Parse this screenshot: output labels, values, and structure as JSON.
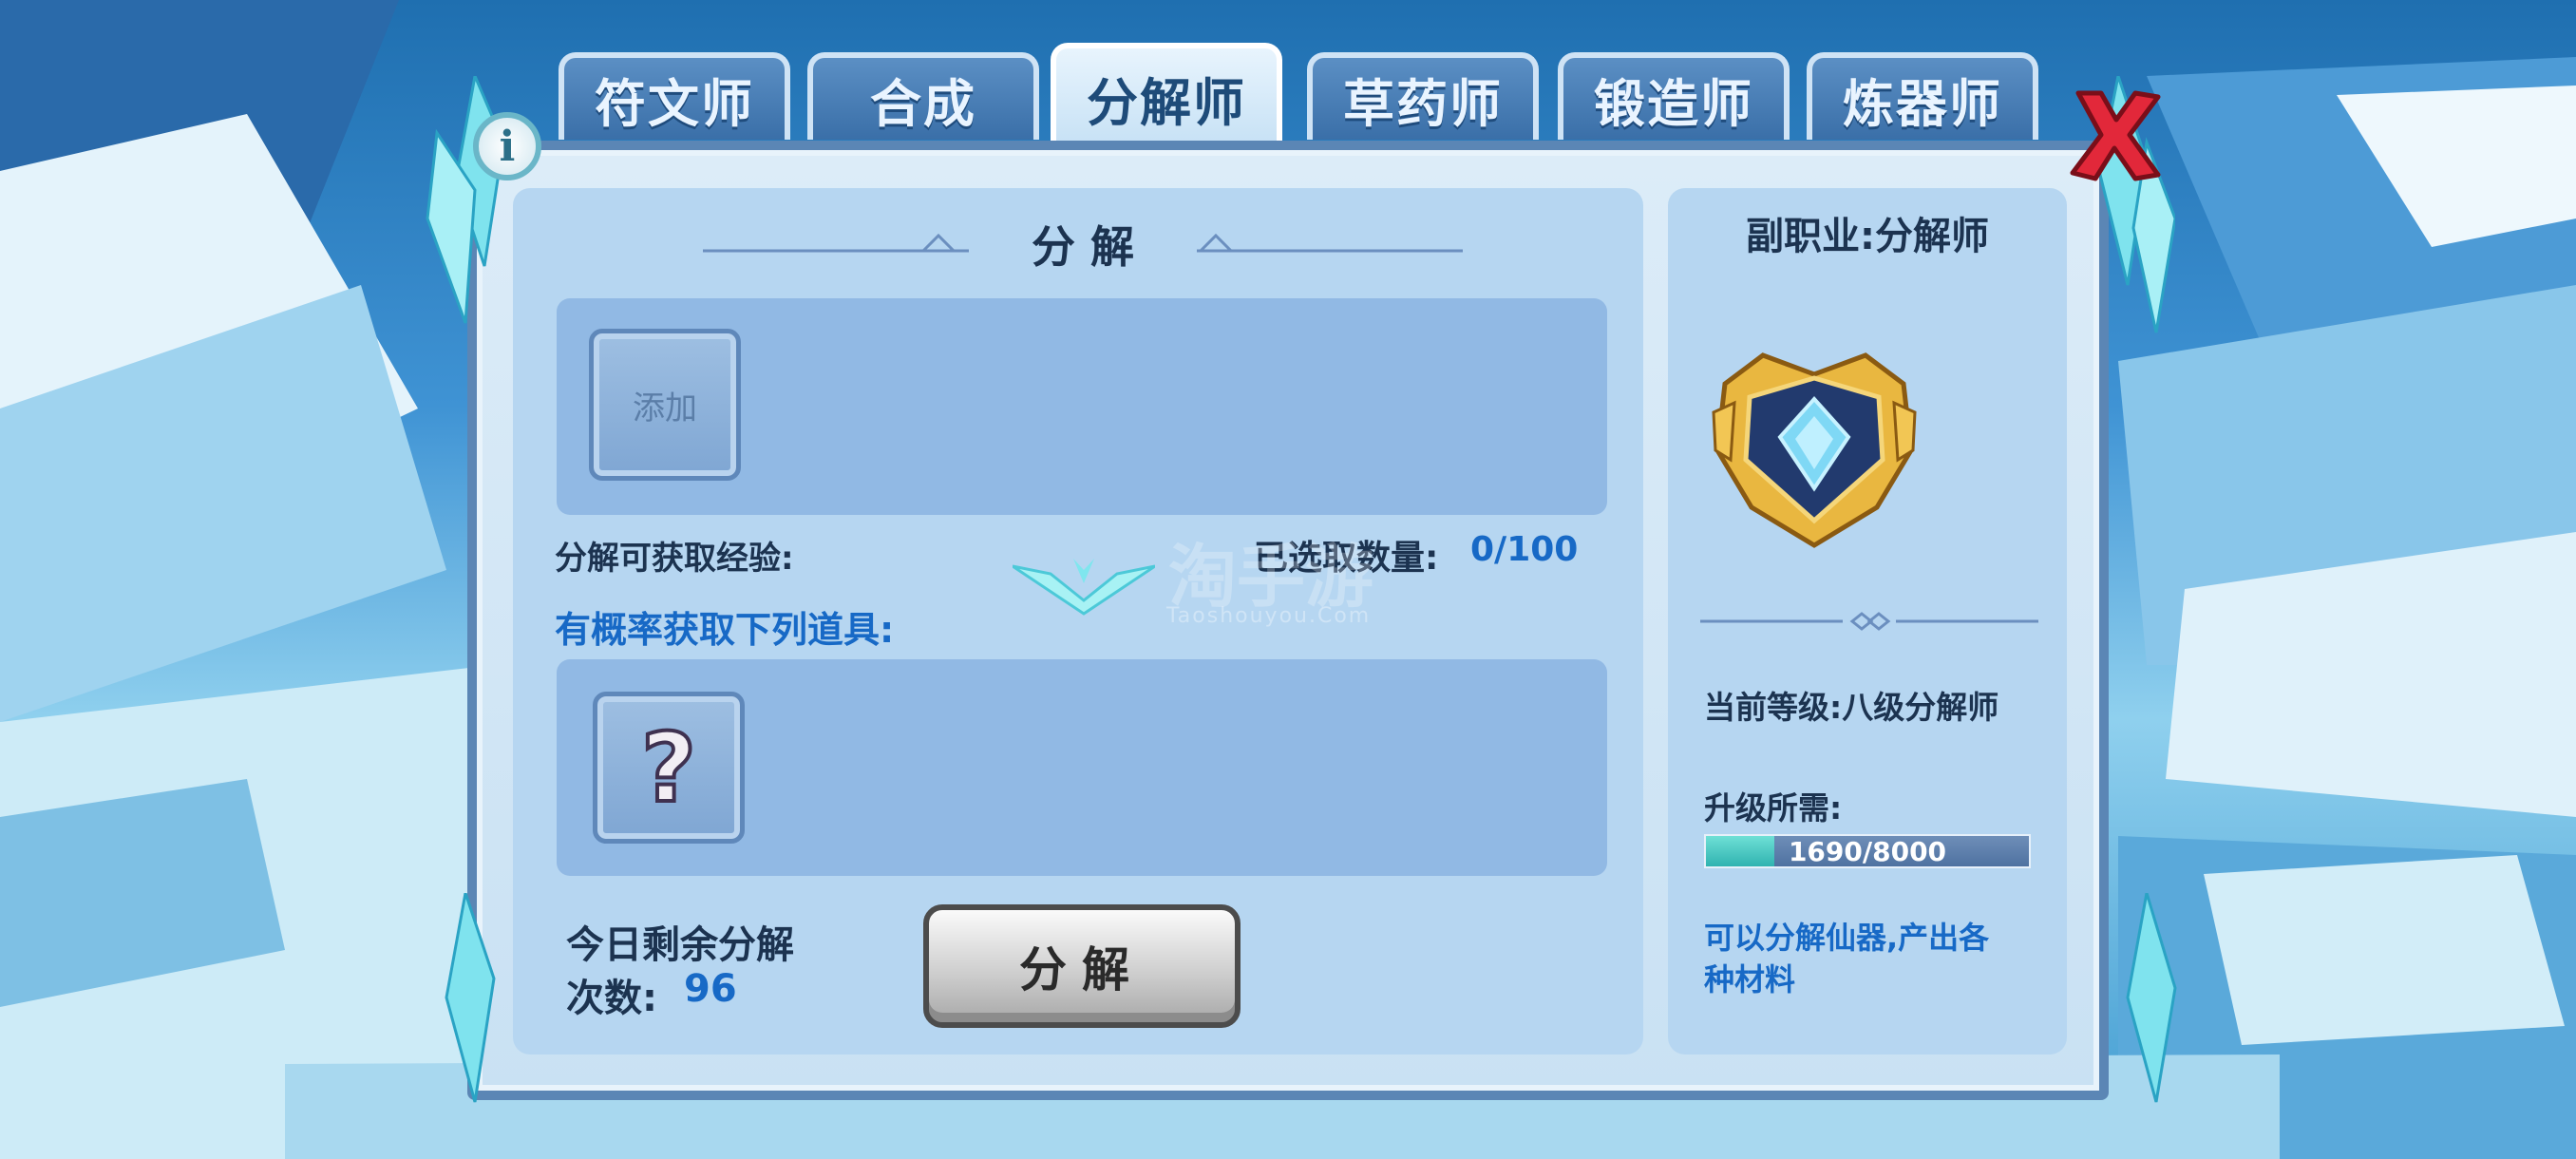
{
  "tabs": [
    {
      "label": "符文师",
      "active": false
    },
    {
      "label": "合成",
      "active": false
    },
    {
      "label": "分解师",
      "active": true
    },
    {
      "label": "草药师",
      "active": false
    },
    {
      "label": "锻造师",
      "active": false
    },
    {
      "label": "炼器师",
      "active": false
    }
  ],
  "main": {
    "section_title": "分 解",
    "add_slot_label": "添加",
    "exp_label": "分解可获取经验:",
    "selected_count_label": "已选取数量:",
    "selected_count_value": "0/100",
    "drops_title": "有概率获取下列道具:",
    "unknown_item_glyph": "?",
    "remaining_label_line1": "今日剩余分解",
    "remaining_label_line2": "次数:",
    "remaining_value": "96",
    "decompose_button": "分解"
  },
  "side": {
    "profession_title": "副职业:分解师",
    "emblem_icon": "gold-crest-emblem-icon",
    "current_level": "当前等级:八级分解师",
    "upgrade_label": "升级所需:",
    "progress_text": "1690/8000",
    "progress_current": 1690,
    "progress_max": 8000,
    "description": [
      "可以分解仙器,产出各",
      "种材料"
    ]
  },
  "watermark": {
    "line1": "淘手游",
    "line2": "Taoshouyou.Com"
  },
  "colors": {
    "accent_blue": "#1769c6",
    "dark_text": "#1c3350",
    "progress_fill": "#2fb3b0",
    "close_red": "#e2283a"
  }
}
